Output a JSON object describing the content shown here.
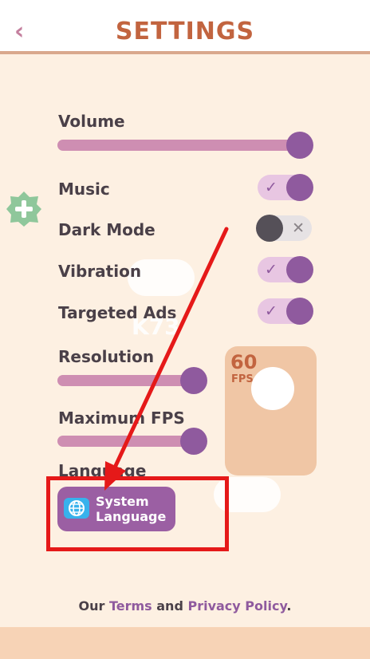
{
  "header": {
    "back_icon": "chevron-left-icon",
    "title": "SETTINGS"
  },
  "volume": {
    "label": "Volume",
    "level": 1.0
  },
  "music": {
    "label": "Music",
    "on": true
  },
  "dark_mode": {
    "label": "Dark Mode",
    "on": false
  },
  "vibration": {
    "label": "Vibration",
    "on": true
  },
  "targeted_ads": {
    "label": "Targeted Ads",
    "on": true
  },
  "resolution": {
    "label": "Resolution",
    "level": 1.0
  },
  "max_fps": {
    "label": "Maximum FPS",
    "level": 1.0
  },
  "fps_preview": {
    "value": "60",
    "unit": "FPS"
  },
  "language": {
    "label": "Language",
    "button_line1": "System",
    "button_line2": "Language",
    "icon": "globe-icon"
  },
  "footer": {
    "prefix": "Our ",
    "terms": "Terms",
    "and": " and ",
    "privacy": "Privacy Policy",
    "suffix": "."
  },
  "toggle_marks": {
    "on": "✓",
    "off": "✕"
  },
  "watermark": "K73",
  "colors": {
    "accent_purple": "#8F5A9E",
    "title_orange": "#C2643F",
    "background": "#FDF0E2",
    "annotation_red": "#E51919"
  }
}
